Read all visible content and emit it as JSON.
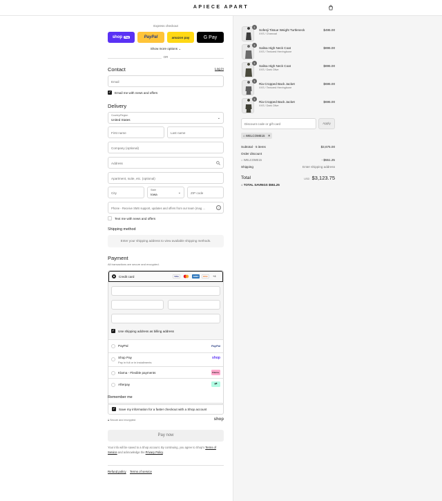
{
  "brand": "APIECE APART",
  "express": {
    "title": "Express checkout",
    "buttons": [
      {
        "label": "shop",
        "sub": "Pay",
        "bg": "#5a31f4",
        "fg": "#ffffff"
      },
      {
        "label": "PayPal",
        "bg": "#ffc439",
        "fg": "#253b80"
      },
      {
        "label": "amazon pay",
        "bg": "#ffd814",
        "fg": "#232f3e"
      },
      {
        "label": "G Pay",
        "bg": "#000000",
        "fg": "#ffffff"
      }
    ],
    "more": "Show more options",
    "or": "OR"
  },
  "contact": {
    "title": "Contact",
    "login": "Log in",
    "email_placeholder": "Email",
    "news_label": "Email me with news and offers"
  },
  "delivery": {
    "title": "Delivery",
    "country_label": "Country/Region",
    "country_value": "United States",
    "first_name": "First name",
    "last_name": "Last name",
    "company": "Company (optional)",
    "address": "Address",
    "apartment": "Apartment, suite, etc. (optional)",
    "city": "City",
    "state_label": "State",
    "state_value": "Iowa",
    "zip": "ZIP code",
    "phone": "Phone - Receive SMS support, updates and offers from our team (mag ...",
    "text_label": "Text me with news and offers"
  },
  "shipping_method": {
    "title": "Shipping method",
    "message": "Enter your shipping address to view available shipping methods."
  },
  "payment": {
    "title": "Payment",
    "subtitle": "All transactions are secure and encrypted.",
    "credit_card": "Credit card",
    "card_brands": [
      "VISA",
      "MC",
      "AMEX",
      "DISC",
      "+4"
    ],
    "billing_label": "Use shipping address as billing address",
    "options": [
      {
        "label": "PayPal",
        "sub": "",
        "logo": "PayPal"
      },
      {
        "label": "Shop Pay",
        "sub": "Pay in full or in installments",
        "logo": "shop"
      },
      {
        "label": "Klarna - Flexible payments",
        "sub": "",
        "logo": "Klarna."
      },
      {
        "label": "Afterpay",
        "sub": "",
        "logo": "afterpay-icon"
      }
    ]
  },
  "remember": {
    "title": "Remember me",
    "label": "Save my information for a faster checkout with a Shop account",
    "secure": "Secure and encrypted",
    "shop_logo": "shop"
  },
  "pay_now": "Pay now",
  "legal": {
    "text1": "Your info will be saved to a Shop account. By continuing, you agree to Shop's",
    "terms": "Terms of Service",
    "and": "and acknowledge the",
    "privacy": "Privacy Policy",
    "end": "."
  },
  "footer": {
    "refund": "Refund policy",
    "terms": "Terms of service"
  },
  "cart": {
    "items": [
      {
        "qty": "1",
        "name": "Sofesji Tissue Weight Turtleneck",
        "variant": "XXS / Charcoal",
        "price": "$495.00"
      },
      {
        "qty": "1",
        "name": "Salisa High Neck Coat",
        "variant": "XXS / Textured Herringbone",
        "price": "$895.00"
      },
      {
        "qty": "1",
        "name": "Salisa High Neck Coat",
        "variant": "XXS / Dark Olive",
        "price": "$895.00"
      },
      {
        "qty": "1",
        "name": "Ria Cropped Back Jacket",
        "variant": "XXS / Textured Herringbone",
        "price": "$695.00"
      },
      {
        "qty": "1",
        "name": "Ria Cropped Back Jacket",
        "variant": "XXS / Dark Olive",
        "price": "$695.00"
      }
    ],
    "discount_placeholder": "Discount code or gift card",
    "apply": "Apply",
    "code": "WELCOME15",
    "subtotal_label": "Subtotal · 5 items",
    "subtotal": "$3,675.00",
    "order_discount_label": "Order discount",
    "discount_code": "WELCOME15",
    "discount_value": "- $551.25",
    "shipping_label": "Shipping",
    "shipping_value": "Enter shipping address",
    "total_label": "Total",
    "currency": "USD",
    "total": "$3,123.75",
    "savings_label": "TOTAL SAVINGS",
    "savings": "$551.25"
  }
}
